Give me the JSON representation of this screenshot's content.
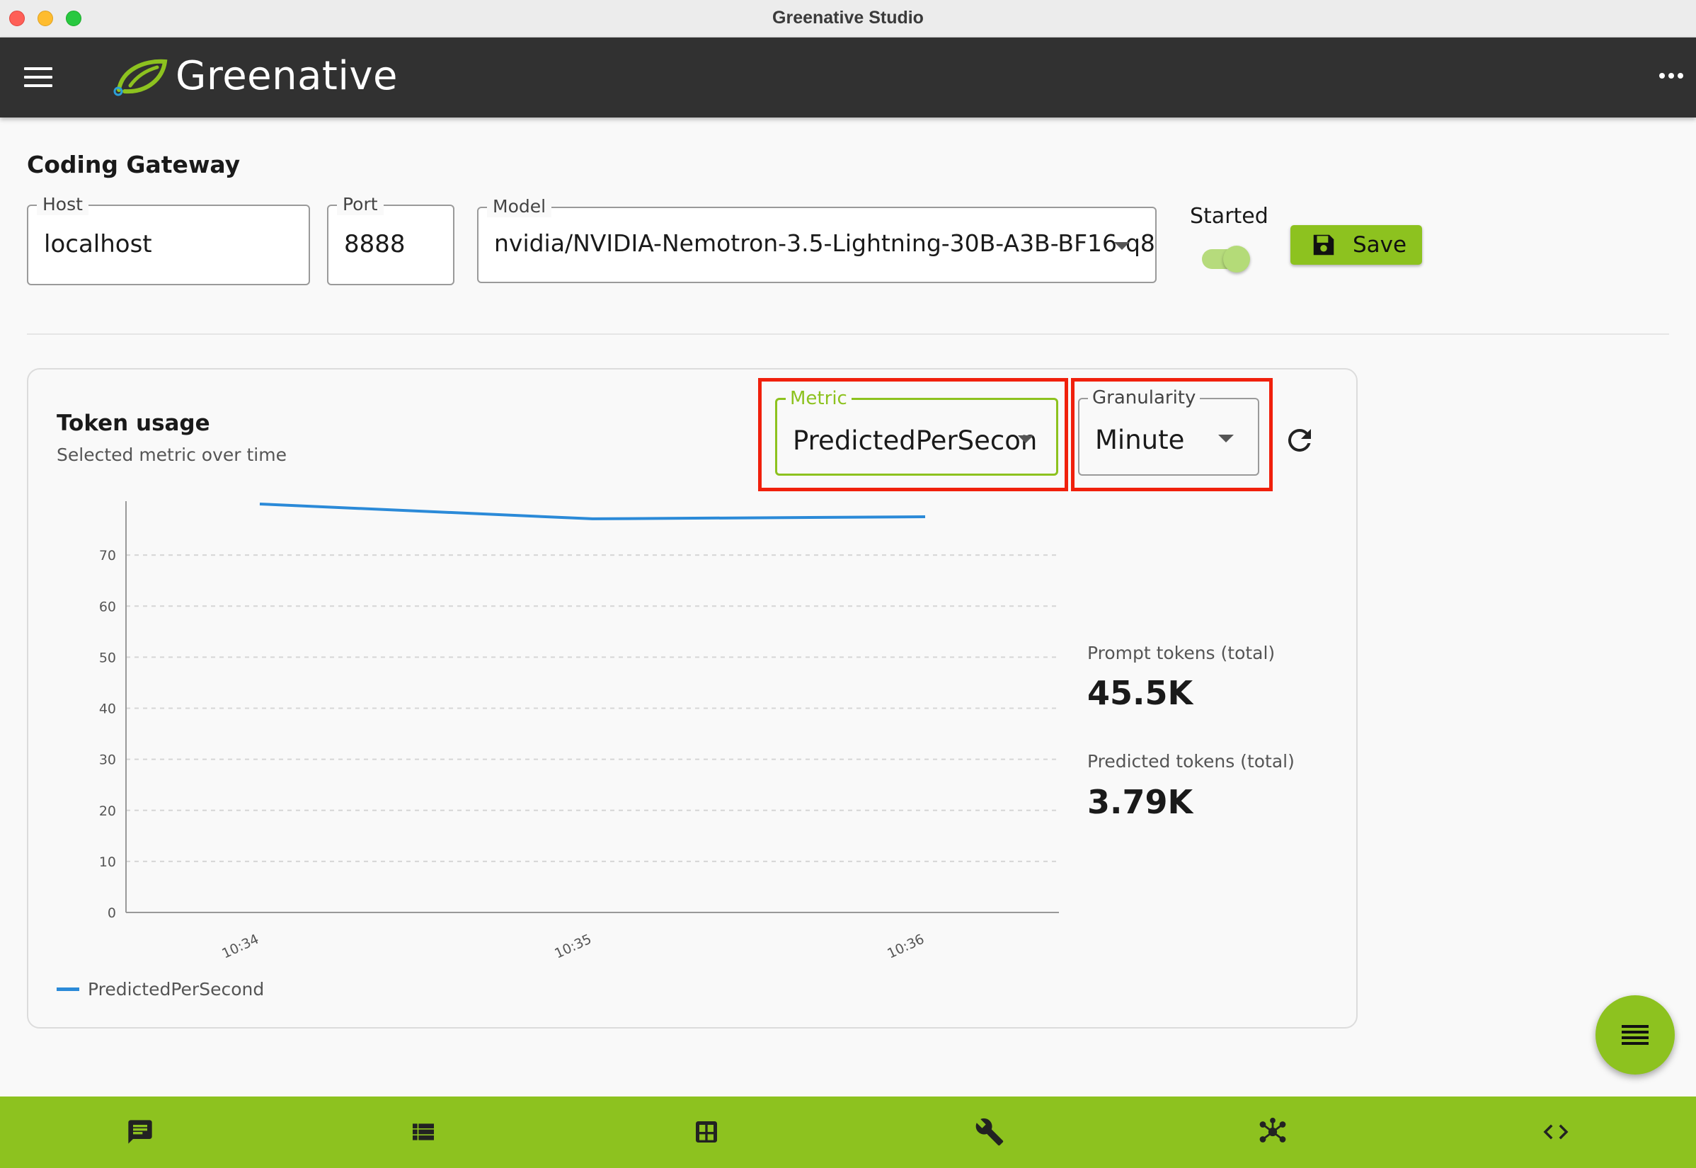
{
  "window": {
    "title": "Greenative Studio"
  },
  "header": {
    "brand": "Greenative",
    "colors": {
      "bar": "#313131",
      "accent": "#8dc21f"
    }
  },
  "gateway": {
    "title": "Coding Gateway",
    "host": {
      "label": "Host",
      "value": "localhost"
    },
    "port": {
      "label": "Port",
      "value": "8888"
    },
    "model": {
      "label": "Model",
      "value": "nvidia/NVIDIA-Nemotron-3.5-Lightning-30B-A3B-BF16-q8"
    },
    "started": {
      "label": "Started",
      "on": true
    },
    "save_label": "Save"
  },
  "token_card": {
    "title": "Token usage",
    "subtitle": "Selected metric over time",
    "metric": {
      "label": "Metric",
      "value": "PredictedPerSecon"
    },
    "granularity": {
      "label": "Granularity",
      "value": "Minute"
    },
    "stats": [
      {
        "label": "Prompt tokens (total)",
        "value": "45.5K"
      },
      {
        "label": "Predicted tokens (total)",
        "value": "3.79K"
      }
    ]
  },
  "chart_data": {
    "type": "line",
    "x": [
      "10:34",
      "10:35",
      "10:36"
    ],
    "series": [
      {
        "name": "PredictedPerSecond",
        "values": [
          80.0,
          77.1,
          77.5
        ],
        "color": "#2b8ad8"
      }
    ],
    "ylim": [
      0,
      80
    ],
    "yticks": [
      0,
      10,
      20,
      30,
      40,
      50,
      60,
      70
    ],
    "grid": true,
    "legend_position": "bottom-left"
  },
  "bottom_nav": {
    "items": [
      {
        "icon": "chat-icon"
      },
      {
        "icon": "list-icon"
      },
      {
        "icon": "grid-icon"
      },
      {
        "icon": "wrench-icon"
      },
      {
        "icon": "network-icon"
      },
      {
        "icon": "code-icon"
      }
    ]
  },
  "fab": {
    "icon": "menu-lines-icon"
  }
}
